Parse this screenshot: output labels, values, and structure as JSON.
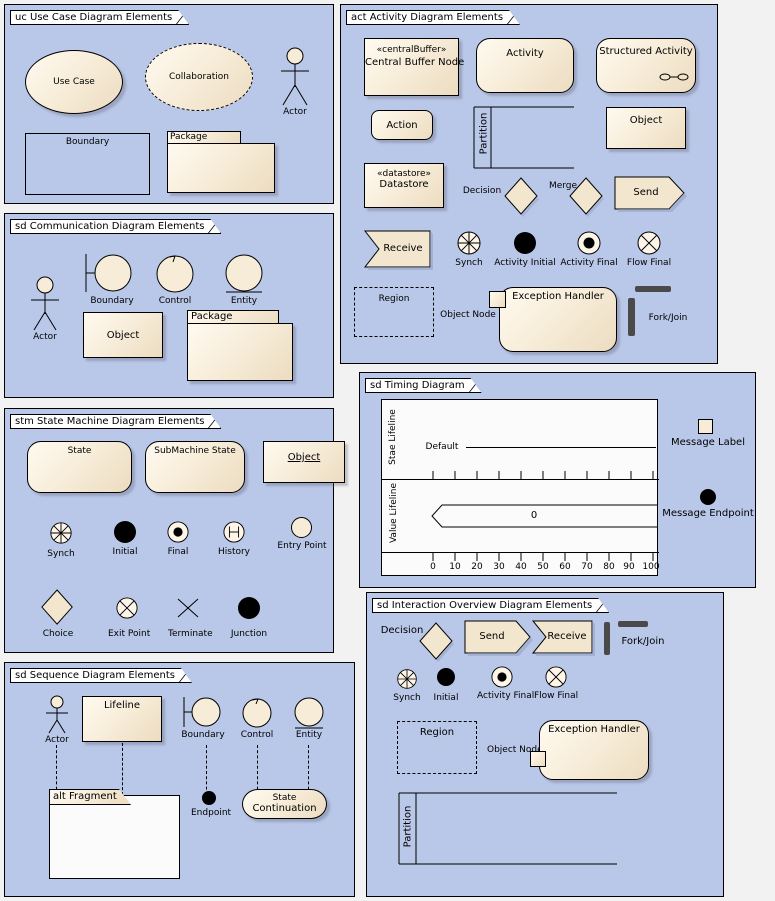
{
  "panels": {
    "usecase": {
      "title": "uc Use Case Diagram Elements",
      "elements": {
        "use_case": "Use Case",
        "collaboration": "Collaboration",
        "actor": "Actor",
        "boundary": "Boundary",
        "package": "Package"
      }
    },
    "activity": {
      "title": "act Activity Diagram Elements",
      "elements": {
        "central_buffer_stereotype": "«centralBuffer»",
        "central_buffer": "Central Buffer Node",
        "activity": "Activity",
        "structured_activity": "Structured Activity",
        "action": "Action",
        "partition": "Partition",
        "object": "Object",
        "datastore_stereotype": "«datastore»",
        "datastore": "Datastore",
        "decision": "Decision",
        "merge": "Merge",
        "send": "Send",
        "receive": "Receive",
        "synch": "Synch",
        "activity_initial": "Activity Initial",
        "activity_final": "Activity Final",
        "flow_final": "Flow Final",
        "region": "Region",
        "object_node": "Object Node",
        "exception_handler": "Exception Handler",
        "fork_join": "Fork/Join"
      }
    },
    "communication": {
      "title": "sd Communication Diagram Elements",
      "elements": {
        "actor": "Actor",
        "boundary": "Boundary",
        "control": "Control",
        "entity": "Entity",
        "object": "Object",
        "package": "Package"
      }
    },
    "statemachine": {
      "title": "stm State Machine Diagram Elements",
      "elements": {
        "state": "State",
        "submachine_state": "SubMachine State",
        "object": "Object",
        "synch": "Synch",
        "initial": "Initial",
        "final": "Final",
        "history": "History",
        "history_glyph": "H",
        "entry_point": "Entry Point",
        "choice": "Choice",
        "exit_point": "Exit Point",
        "terminate": "Terminate",
        "junction": "Junction"
      }
    },
    "sequence": {
      "title": "sd Sequence Diagram Elements",
      "elements": {
        "actor": "Actor",
        "lifeline": "Lifeline",
        "boundary": "Boundary",
        "control": "Control",
        "entity": "Entity",
        "fragment": "alt Fragment",
        "endpoint": "Endpoint",
        "state_continuation_line1": "State",
        "state_continuation_line2": "Continuation"
      }
    },
    "timing": {
      "title": "sd Timing Diagram",
      "elements": {
        "state_lifeline": "Stae Lifeline",
        "value_lifeline": "Value Lifeline",
        "default": "Default",
        "value": "0",
        "message_label": "Message Label",
        "message_endpoint": "Message Endpoint"
      },
      "axis_ticks": [
        "0",
        "10",
        "20",
        "30",
        "40",
        "50",
        "60",
        "70",
        "80",
        "90",
        "100"
      ]
    },
    "interaction": {
      "title": "sd Interaction Overview Diagram Elements",
      "elements": {
        "decision": "Decision",
        "send": "Send",
        "receive": "Receive",
        "fork_join": "Fork/Join",
        "synch": "Synch",
        "initial": "Initial",
        "activity_final": "Activity Final",
        "flow_final": "Flow Final",
        "region": "Region",
        "object_node": "Object Node",
        "exception_handler": "Exception Handler",
        "partition": "Partition"
      }
    }
  },
  "colors": {
    "panel_fill": "#b9c7e8",
    "shape_fill": "#f7ecd8",
    "page_background": "#f2f2f2",
    "outline": "#000000",
    "fork_bar": "#4a4a4a"
  }
}
